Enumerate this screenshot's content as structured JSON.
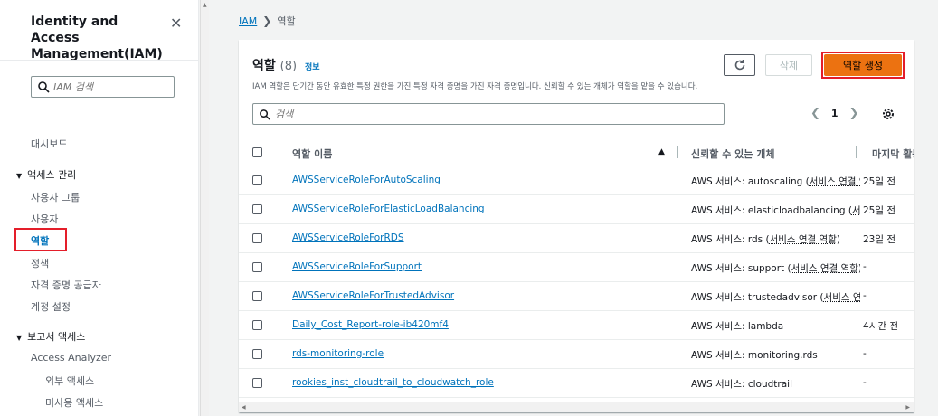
{
  "sidebar": {
    "title": "Identity and Access Management(IAM)",
    "search_placeholder": "IAM 검색",
    "dashboard": "대시보드",
    "access_mgmt": {
      "label": "액세스 관리",
      "items": [
        "사용자 그룹",
        "사용자",
        "역할",
        "정책",
        "자격 증명 공급자",
        "계정 설정"
      ]
    },
    "report_access": {
      "label": "보고서 액세스",
      "items": [
        "Access Analyzer",
        "외부 액세스",
        "미사용 액세스"
      ]
    }
  },
  "breadcrumb": {
    "root": "IAM",
    "current": "역할"
  },
  "panel": {
    "title": "역할",
    "count": "(8)",
    "info": "정보",
    "description": "IAM 역할은 단기간 동안 유효한 특정 권한을 가진 특정 자격 증명을 가진 자격 증명입니다. 신뢰할 수 있는 개체가 역할을 맡을 수 있습니다.",
    "delete_label": "삭제",
    "create_label": "역할 생성",
    "search_placeholder": "검색",
    "page": "1"
  },
  "table": {
    "columns": [
      "역할 이름",
      "신뢰할 수 있는 개체",
      "마지막 활동"
    ],
    "rows": [
      {
        "name": "AWSServiceRoleForAutoScaling",
        "entity_prefix": "AWS 서비스: autoscaling (",
        "entity_svc": "서비스 연결 역할",
        "entity_suffix": ")",
        "last": "25일 전"
      },
      {
        "name": "AWSServiceRoleForElasticLoadBalancing",
        "entity_prefix": "AWS 서비스: elasticloadbalancing (",
        "entity_svc": "서비스 연결 역할",
        "entity_suffix": ")",
        "last": "25일 전"
      },
      {
        "name": "AWSServiceRoleForRDS",
        "entity_prefix": "AWS 서비스: rds (",
        "entity_svc": "서비스 연결 역할",
        "entity_suffix": ")",
        "last": "23일 전"
      },
      {
        "name": "AWSServiceRoleForSupport",
        "entity_prefix": "AWS 서비스: support (",
        "entity_svc": "서비스 연결 역할",
        "entity_suffix": ")",
        "last": "-"
      },
      {
        "name": "AWSServiceRoleForTrustedAdvisor",
        "entity_prefix": "AWS 서비스: trustedadvisor (",
        "entity_svc": "서비스 연결 역할",
        "entity_suffix": ")",
        "last": "-"
      },
      {
        "name": "Daily_Cost_Report-role-ib420mf4",
        "entity_prefix": "AWS 서비스: lambda",
        "entity_svc": "",
        "entity_suffix": "",
        "last": "4시간 전"
      },
      {
        "name": "rds-monitoring-role",
        "entity_prefix": "AWS 서비스: monitoring.rds",
        "entity_svc": "",
        "entity_suffix": "",
        "last": "-"
      },
      {
        "name": "rookies_inst_cloudtrail_to_cloudwatch_role",
        "entity_prefix": "AWS 서비스: cloudtrail",
        "entity_svc": "",
        "entity_suffix": "",
        "last": "-"
      }
    ]
  },
  "colors": {
    "link": "#0073bb",
    "primary_button": "#ec7211",
    "highlight_box": "#e41e2a"
  }
}
